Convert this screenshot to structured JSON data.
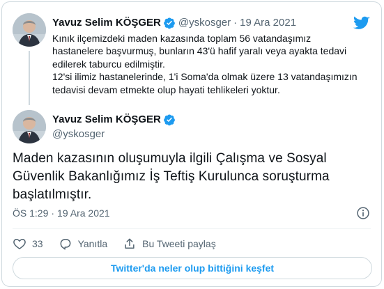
{
  "colors": {
    "accent": "#1d9bf0",
    "text": "#0f1419",
    "muted": "#536471",
    "border": "#cfd9de"
  },
  "quoted_tweet": {
    "author_name": "Yavuz Selim KÖŞGER",
    "handle": "@yskosger",
    "separator": "·",
    "date": "19 Ara 2021",
    "text_para_1": "Kınık ilçemizdeki maden kazasında toplam 56 vatandaşımız hastanelere başvurmuş, bunların 43'ü hafif yaralı veya ayakta tedavi edilerek taburcu edilmiştir.",
    "text_para_2": "12'si ilimiz hastanelerinde, 1'i Soma'da olmak üzere 13 vatandaşımızın tedavisi devam etmekte olup hayati tehlikeleri yoktur.",
    "icons": [
      "avatar",
      "verified-badge-icon"
    ]
  },
  "main_tweet": {
    "author_name": "Yavuz Selim KÖŞGER",
    "handle": "@yskosger",
    "text": "Maden kazasının oluşumuyla ilgili Çalışma ve Sosyal Güvenlik Bakanlığımız İş Teftiş Kurulunca soruşturma başlatılmıştır.",
    "time": "ÖS 1:29",
    "separator": "·",
    "date": "19 Ara 2021",
    "icons": [
      "avatar",
      "verified-badge-icon",
      "info-icon"
    ]
  },
  "actions": {
    "like_count": "33",
    "reply_label": "Yanıtla",
    "share_label": "Bu Tweeti paylaş",
    "icons": [
      "heart-icon",
      "reply-icon",
      "share-icon"
    ]
  },
  "cta_label": "Twitter'da neler olup bittiğini keşfet",
  "brand_icon": "twitter-bird-icon"
}
